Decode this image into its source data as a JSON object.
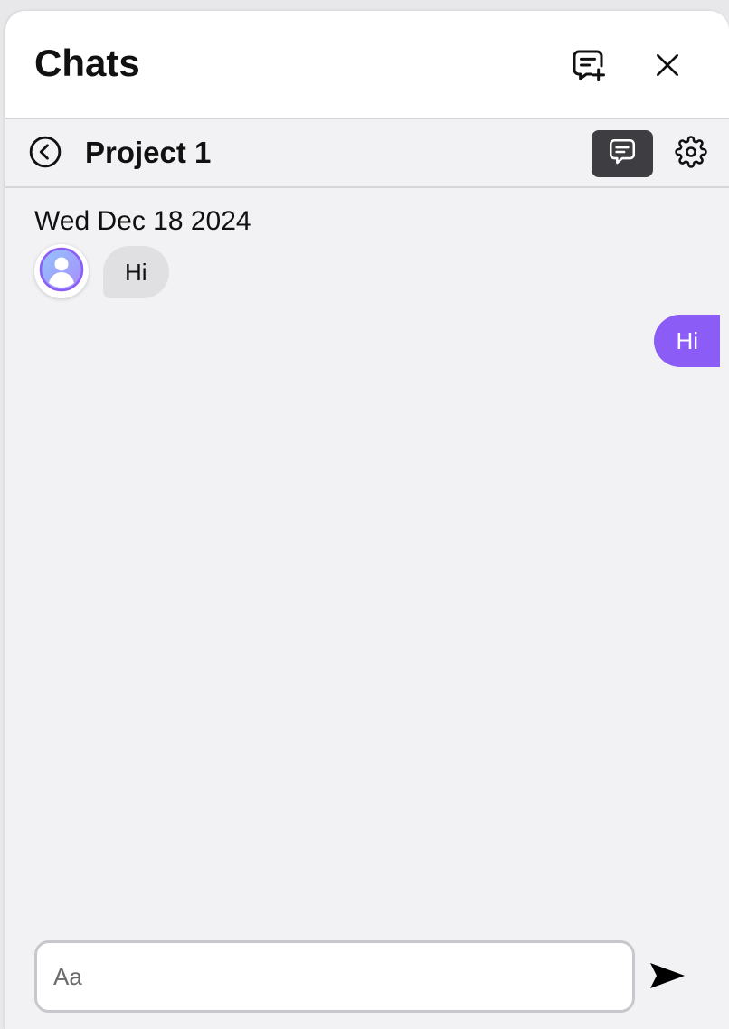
{
  "header": {
    "title": "Chats",
    "new_chat_icon": "message-plus-icon",
    "close_icon": "close-icon"
  },
  "conversation": {
    "back_icon": "chevron-left-circle-icon",
    "title": "Project 1",
    "chat_icon": "message-square-icon",
    "settings_icon": "gear-icon"
  },
  "messages": {
    "date": "Wed Dec 18 2024",
    "incoming": [
      {
        "avatar_icon": "user-avatar-icon",
        "text": "Hi"
      }
    ],
    "outgoing": [
      {
        "text": "Hi"
      }
    ]
  },
  "composer": {
    "placeholder": "Aa",
    "value": "",
    "send_icon": "send-icon"
  },
  "colors": {
    "accent": "#8b5cf6",
    "incoming_bubble": "#e0e0e2",
    "active_button": "#3d3d42",
    "panel_background": "#f2f2f4"
  }
}
